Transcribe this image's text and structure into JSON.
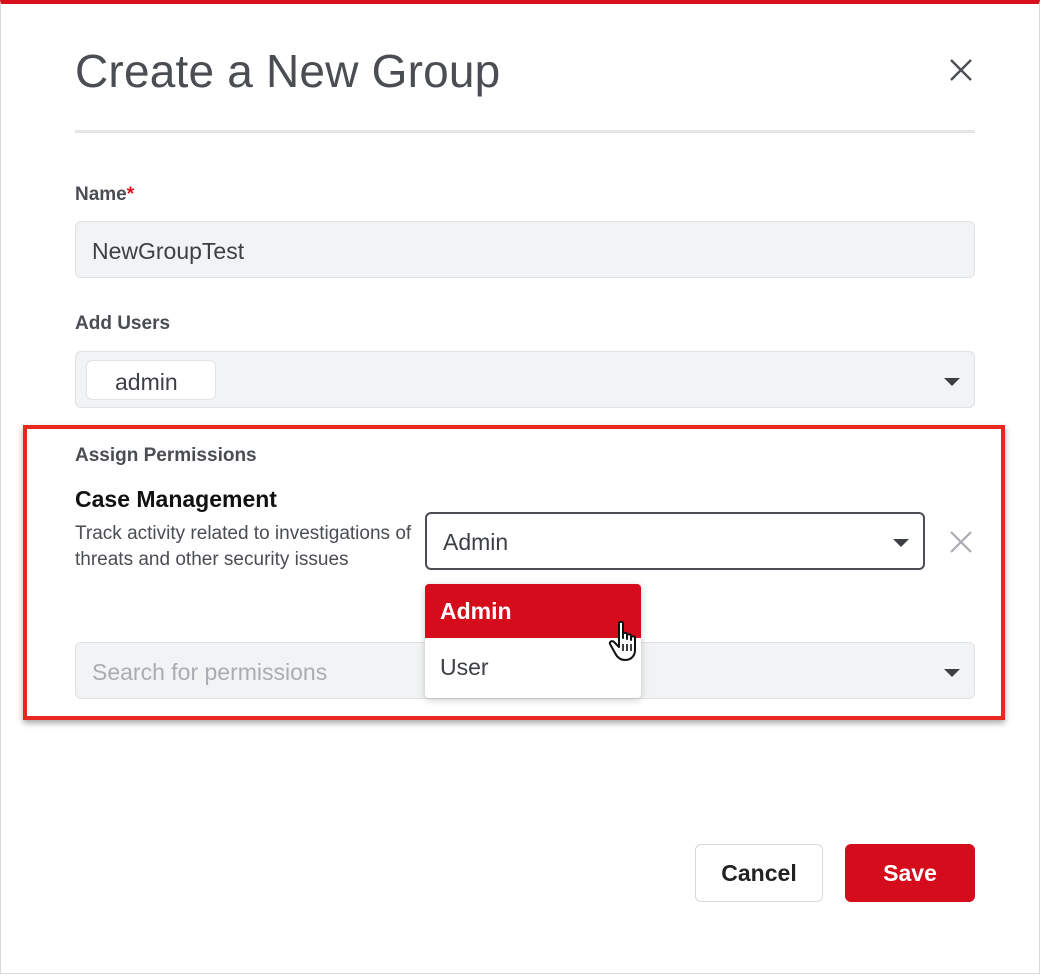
{
  "dialog": {
    "title": "Create a New Group",
    "close_icon": "close-icon"
  },
  "name_field": {
    "label": "Name",
    "required_marker": "*",
    "value": "NewGroupTest"
  },
  "users_field": {
    "label": "Add Users",
    "chips": [
      "admin"
    ]
  },
  "permissions": {
    "section_label": "Assign Permissions",
    "item": {
      "title": "Case Management",
      "description": "Track activity related to investigations of threats and other security issues",
      "selected_role": "Admin"
    },
    "dropdown_options": [
      {
        "label": "Admin",
        "active": true
      },
      {
        "label": "User",
        "active": false
      }
    ],
    "search_placeholder": "Search for permissions"
  },
  "actions": {
    "cancel_label": "Cancel",
    "save_label": "Save"
  },
  "colors": {
    "accent": "#d40c1c",
    "highlight_border": "#e8271f"
  }
}
